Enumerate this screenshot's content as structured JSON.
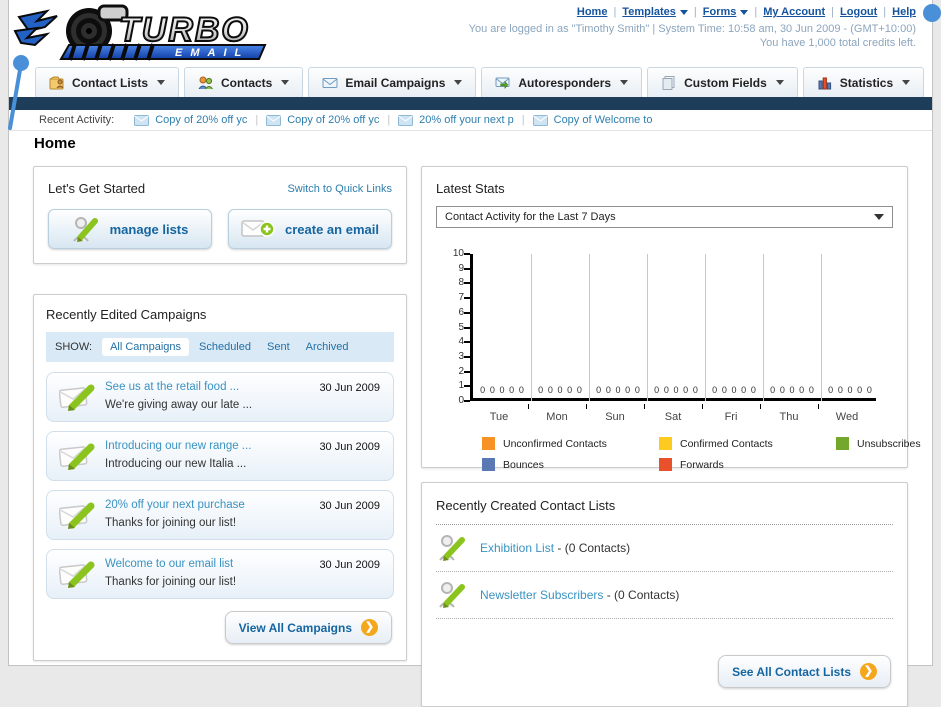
{
  "header": {
    "logo": {
      "line1": "TURBO",
      "line2": "EMAIL"
    },
    "links": [
      {
        "label": "Home"
      },
      {
        "label": "Templates"
      },
      {
        "label": "Forms"
      },
      {
        "label": "My Account"
      },
      {
        "label": "Logout"
      },
      {
        "label": "Help"
      }
    ],
    "status_line1": "You are logged in as \"Timothy Smith\" | System Time: 10:58 am, 30 Jun 2009 - (GMT+10:00)",
    "status_line2": "You have 1,000 total credits left."
  },
  "nav": {
    "tabs": [
      {
        "label": "Contact Lists"
      },
      {
        "label": "Contacts"
      },
      {
        "label": "Email Campaigns"
      },
      {
        "label": "Autoresponders"
      },
      {
        "label": "Custom Fields"
      },
      {
        "label": "Statistics"
      }
    ]
  },
  "recent_activity": {
    "label": "Recent Activity:",
    "items": [
      {
        "label": "Copy of 20% off yc"
      },
      {
        "label": "Copy of 20% off yc"
      },
      {
        "label": "20% off your next p"
      },
      {
        "label": "Copy of Welcome to"
      }
    ]
  },
  "page": {
    "title": "Home"
  },
  "get_started": {
    "title": "Let's Get Started",
    "switch_link": "Switch to Quick Links",
    "manage_lists_label": "manage lists",
    "create_email_label": "create an email"
  },
  "campaigns": {
    "title": "Recently Edited Campaigns",
    "show_label": "SHOW:",
    "filters": [
      {
        "label": "All Campaigns",
        "active": true
      },
      {
        "label": "Scheduled"
      },
      {
        "label": "Sent"
      },
      {
        "label": "Archived"
      }
    ],
    "items": [
      {
        "title": "See us at the retail food ...",
        "subtitle": "We're giving away our late ...",
        "date": "30 Jun 2009"
      },
      {
        "title": "Introducing our new range ...",
        "subtitle": "Introducing our new Italia ...",
        "date": "30 Jun 2009"
      },
      {
        "title": "20% off your next purchase",
        "subtitle": "Thanks for joining our list!",
        "date": "30 Jun 2009"
      },
      {
        "title": "Welcome to our email list",
        "subtitle": "Thanks for joining our list!",
        "date": "30 Jun 2009"
      }
    ],
    "view_all_label": "View All Campaigns"
  },
  "stats": {
    "title": "Latest Stats",
    "dropdown_value": "Contact Activity for the Last 7 Days"
  },
  "chart_data": {
    "type": "bar",
    "categories": [
      "Tue",
      "Mon",
      "Sun",
      "Sat",
      "Fri",
      "Thu",
      "Wed"
    ],
    "series": [
      {
        "name": "Unconfirmed Contacts",
        "color": "#f79226",
        "values": [
          0,
          0,
          0,
          0,
          0,
          0,
          0
        ]
      },
      {
        "name": "Confirmed Contacts",
        "color": "#fdca1f",
        "values": [
          0,
          0,
          0,
          0,
          0,
          0,
          0
        ]
      },
      {
        "name": "Unsubscribes",
        "color": "#74a82c",
        "values": [
          0,
          0,
          0,
          0,
          0,
          0,
          0
        ]
      },
      {
        "name": "Bounces",
        "color": "#5a78b4",
        "values": [
          0,
          0,
          0,
          0,
          0,
          0,
          0
        ]
      },
      {
        "name": "Forwards",
        "color": "#e8512b",
        "values": [
          0,
          0,
          0,
          0,
          0,
          0,
          0
        ]
      }
    ],
    "ylim": [
      0,
      10
    ],
    "ytick_step": 1,
    "grid": "vertical",
    "legend_position": "bottom",
    "data_labels_shown": true
  },
  "contact_lists": {
    "title": "Recently Created Contact Lists",
    "items": [
      {
        "name": "Exhibition List",
        "suffix": " - (0 Contacts)"
      },
      {
        "name": "Newsletter Subscribers",
        "suffix": " - (0 Contacts)"
      }
    ],
    "see_all_label": "See All Contact Lists"
  },
  "colors": {
    "navy_bar": "#1e3d5a",
    "link_blue": "#15539e",
    "teal_link": "#3a93c2",
    "accent_orange": "#f5a71c",
    "brand_blue": "#2361c4"
  }
}
